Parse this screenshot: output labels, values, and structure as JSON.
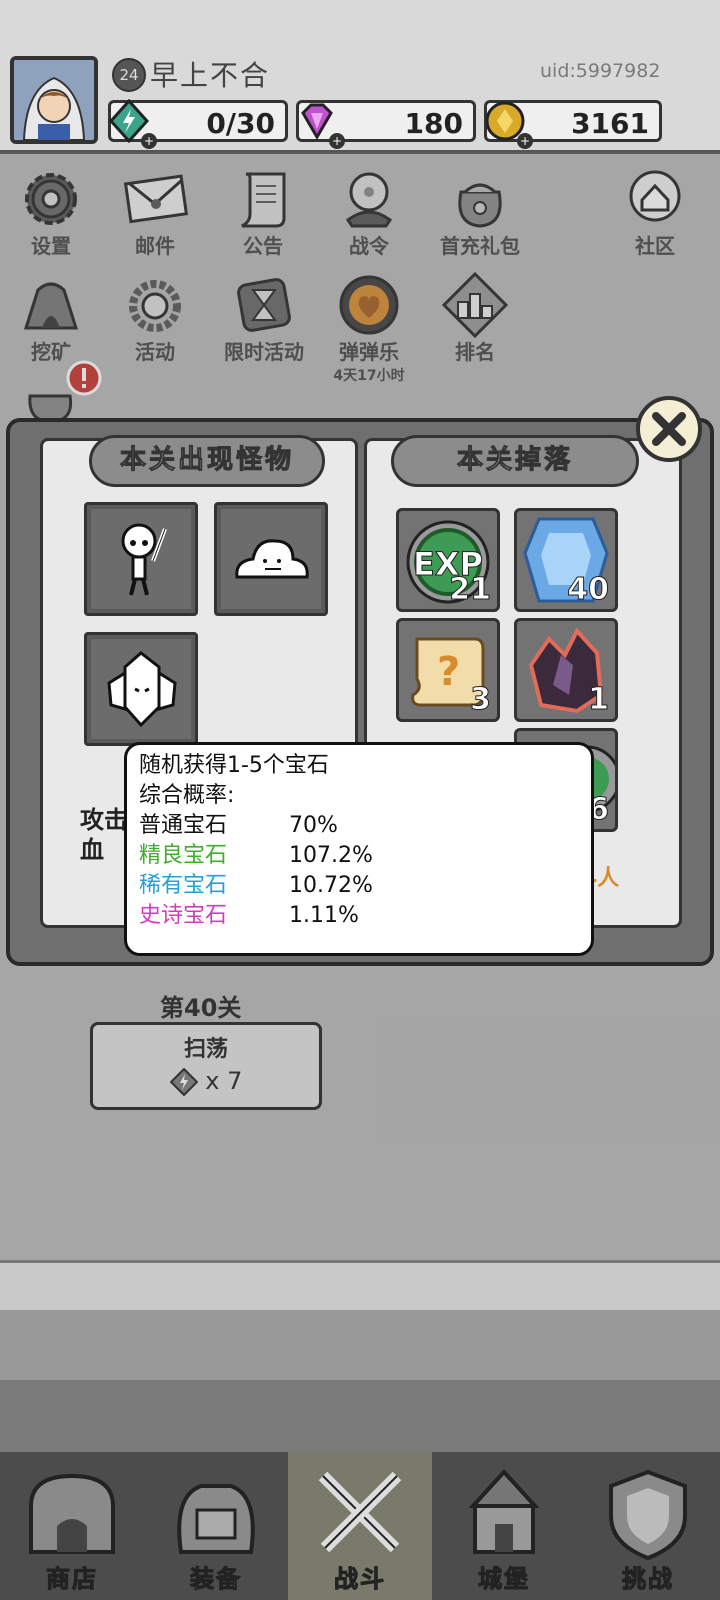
{
  "player": {
    "level": "24",
    "name": "早上不合",
    "uid": "uid:5997982"
  },
  "resources": {
    "energy": "0/30",
    "gems": "180",
    "gold": "3161"
  },
  "menu_row1": [
    {
      "label": "设置",
      "icon": "gear-icon"
    },
    {
      "label": "邮件",
      "icon": "mail-icon"
    },
    {
      "label": "公告",
      "icon": "scroll-icon"
    },
    {
      "label": "战令",
      "icon": "orb-icon"
    },
    {
      "label": "首充礼包",
      "icon": "gift-bag-icon"
    },
    {
      "label": "社区",
      "icon": "home-icon"
    }
  ],
  "menu_row2": [
    {
      "label": "挖矿",
      "icon": "mine-icon"
    },
    {
      "label": "活动",
      "icon": "wreath-icon"
    },
    {
      "label": "限时活动",
      "icon": "hourglass-icon"
    },
    {
      "label": "弹弹乐",
      "icon": "pinball-icon",
      "sub": "4天17小时"
    },
    {
      "label": "排名",
      "icon": "podium-icon"
    }
  ],
  "book": {
    "left_title": "本关出现怪物",
    "right_title": "本关掉落",
    "monsters": [
      "skeleton-icon",
      "slime-icon",
      "crystal-golem-icon"
    ],
    "drops": [
      {
        "icon": "exp-icon",
        "count": "21",
        "text": "EXP"
      },
      {
        "icon": "blue-gem-icon",
        "count": "40"
      },
      {
        "icon": "mystery-scroll-icon",
        "count": "3"
      },
      {
        "icon": "dark-crystal-icon",
        "count": "1"
      },
      {
        "icon": "green-orb-icon",
        "count": "76"
      }
    ],
    "partial_left_1": "攻击",
    "partial_left_2": "血",
    "partial_right": "4人"
  },
  "tooltip": {
    "line1": "随机获得1-5个宝石",
    "line2": "综合概率:",
    "rows": [
      {
        "name": "普通宝石",
        "pct": "70%",
        "color": "#111111"
      },
      {
        "name": "精良宝石",
        "pct": "107.2%",
        "color": "#3fae2a"
      },
      {
        "name": "稀有宝石",
        "pct": "10.72%",
        "color": "#2a9ed8"
      },
      {
        "name": "史诗宝石",
        "pct": "1.11%",
        "color": "#d23cc0"
      }
    ]
  },
  "stage": {
    "label": "第40关",
    "sweep_label": "扫荡",
    "sweep_cost": "x 7"
  },
  "nav": [
    {
      "label": "商店",
      "icon": "shop-icon"
    },
    {
      "label": "装备",
      "icon": "backpack-icon"
    },
    {
      "label": "战斗",
      "icon": "crossed-swords-icon",
      "active": true
    },
    {
      "label": "城堡",
      "icon": "castle-icon"
    },
    {
      "label": "挑战",
      "icon": "shield-icon"
    }
  ],
  "colors": {
    "accent_orange": "#d98a2c",
    "tooltip_border": "#111111"
  }
}
